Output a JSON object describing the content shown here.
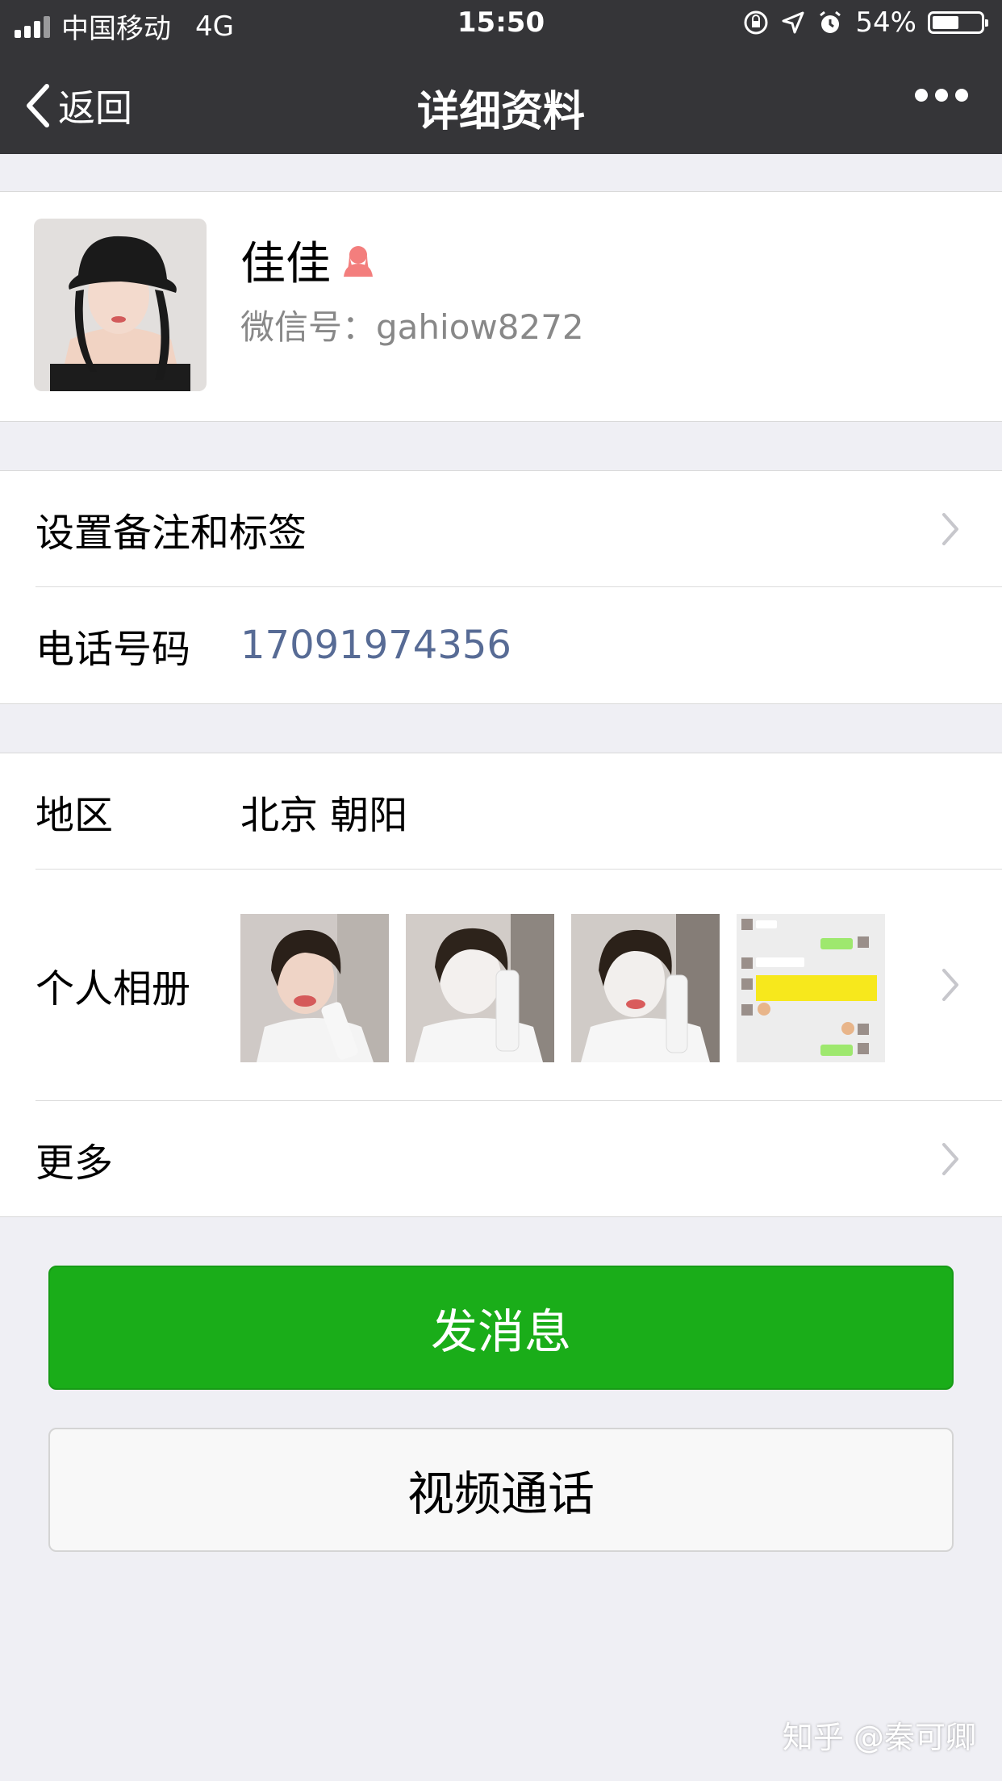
{
  "status_bar": {
    "carrier": "中国移动",
    "network": "4G",
    "time": "15:50",
    "battery": "54%"
  },
  "nav": {
    "back_label": "返回",
    "title": "详细资料"
  },
  "profile": {
    "name": "佳佳",
    "wechat_id_label": "微信号：",
    "wechat_id": "gahiow8272",
    "gender": "female",
    "gender_color": "#f37e7d"
  },
  "rows": {
    "remark_label": "设置备注和标签",
    "phone_label": "电话号码",
    "phone_value": "17091974356",
    "region_label": "地区",
    "region_value": "北京 朝阳",
    "album_label": "个人相册",
    "album_photo_count": 4,
    "more_label": "更多"
  },
  "buttons": {
    "send_message": "发消息",
    "video_call": "视频通话"
  },
  "watermark": "知乎 @秦可卿",
  "colors": {
    "nav_bg": "#353538",
    "primary_green": "#1aad19",
    "link_blue": "#576b95",
    "page_bg": "#efeff4"
  }
}
